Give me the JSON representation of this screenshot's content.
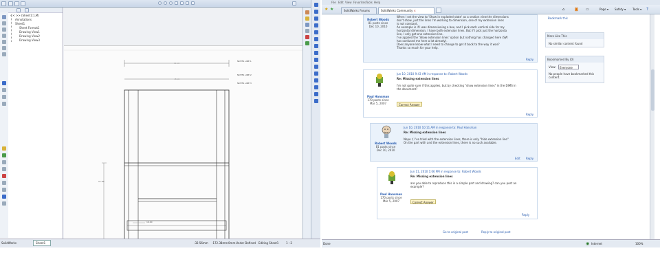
{
  "solidworks": {
    "tree": {
      "root": "<<   >>  (Sheet1:1,M)",
      "items": [
        "Annotations",
        "Sheet1",
        "Sheet Format1",
        "Drawing View1",
        "Drawing View2",
        "Drawing View3"
      ]
    },
    "sheet_tab": "Sheet1",
    "status": {
      "ready": "SolidWorks",
      "coord1": "-32.56mm",
      "coord2": "-172.38mm",
      "coord3": "0mm",
      "state": "Under Defined",
      "mode": "Editing Sheet1",
      "scale": "1 : 2"
    },
    "drawing_dims": [
      "90.00",
      "18.00",
      "11.00",
      "16.00"
    ],
    "notes": [
      "NOTES LINE 1",
      "NOTES LINE 2",
      "NOTES LINE 3"
    ]
  },
  "browser": {
    "menu": [
      "File",
      "Edit",
      "View",
      "Favorites",
      "Tools",
      "Help"
    ],
    "tabs": [
      "SolidWorks Forums",
      "SolidWorks Community"
    ],
    "tab_close": "×",
    "toolbar_right": [
      "Page ▾",
      "Safety ▾",
      "Tools ▾"
    ],
    "posts": [
      {
        "author": "Robert Woods",
        "meta": [
          "81 posts since",
          "Dec 10, 2010"
        ],
        "lines": [
          "When I set the view to 'Show in exploded state' as a section view the dimensions",
          "don't show, just the lines I'm working to dimension, one of my extension lines",
          "is not constant.",
          "An example is if I was dimensioning a box, and I pick each vertical side for my",
          "horizontal dimension, I have both extension lines. But if I pick just the horizonta",
          "line, I only get one extension line.",
          "I've applied the 'Show extension lines' option but nothing has changed here (SW",
          "has confused me here a lot already).",
          "Does anyone know what I need to change to get it back to the way it was?",
          "Thanks so much for your help."
        ],
        "reply": "Reply"
      },
      {
        "author": "Paul Hansman",
        "meta": [
          "170 posts since",
          "Mar 5, 2007"
        ],
        "header": "Jun 10, 2010 9:43 AM  in response to: Robert Woods",
        "title": "Re: Missing extension lines",
        "lines": [
          "I'm not quite sure if this applies, but by checking \"show extension lines\" in the DIMS in",
          "the document?"
        ],
        "button": "Correct Answer",
        "reply": "Reply"
      },
      {
        "author": "Robert Woods",
        "meta": [
          "81 posts since",
          "Dec 10, 2010"
        ],
        "header": "Jun 10, 2010 10:11 AM  in response to: Paul Hansman",
        "title": "Re: Missing extension lines",
        "lines": [
          "Nope :( I've tried with the extension lines, there is only \"hide extension line\"",
          "On the part with and the extension lines, there is no such available."
        ],
        "edit": "Edit",
        "reply": "Reply"
      },
      {
        "author": "Paul Hansman",
        "meta": [
          "170 posts since",
          "Mar 5, 2007"
        ],
        "header": "Jun 11, 2010 1:06 PM  in response to: Robert Woods",
        "title": "Re: Missing extension lines",
        "lines": [
          "are you able to reproduce this in a simple part and drawing? can you post an",
          "example?"
        ],
        "button": "Correct Answer",
        "reply": "Reply"
      }
    ],
    "bottom_links": [
      "Go to original post",
      "Reply to original post"
    ],
    "sidebar": {
      "more_like_this": "More Like This",
      "more_text": "No similar content found",
      "bookmarked": "Bookmarked By (0)",
      "view_label": "View:",
      "view_value": "Everyone",
      "bookmark_text": "No people have bookmarked this content.",
      "top_link": "Bookmark this"
    },
    "status": {
      "left": "Done",
      "zone": "Internet",
      "zoom": "100%"
    }
  },
  "colors": {
    "post_blue": "#eaf2fb",
    "link": "#2a5db0",
    "sw_blue": "#c9d6e8"
  }
}
